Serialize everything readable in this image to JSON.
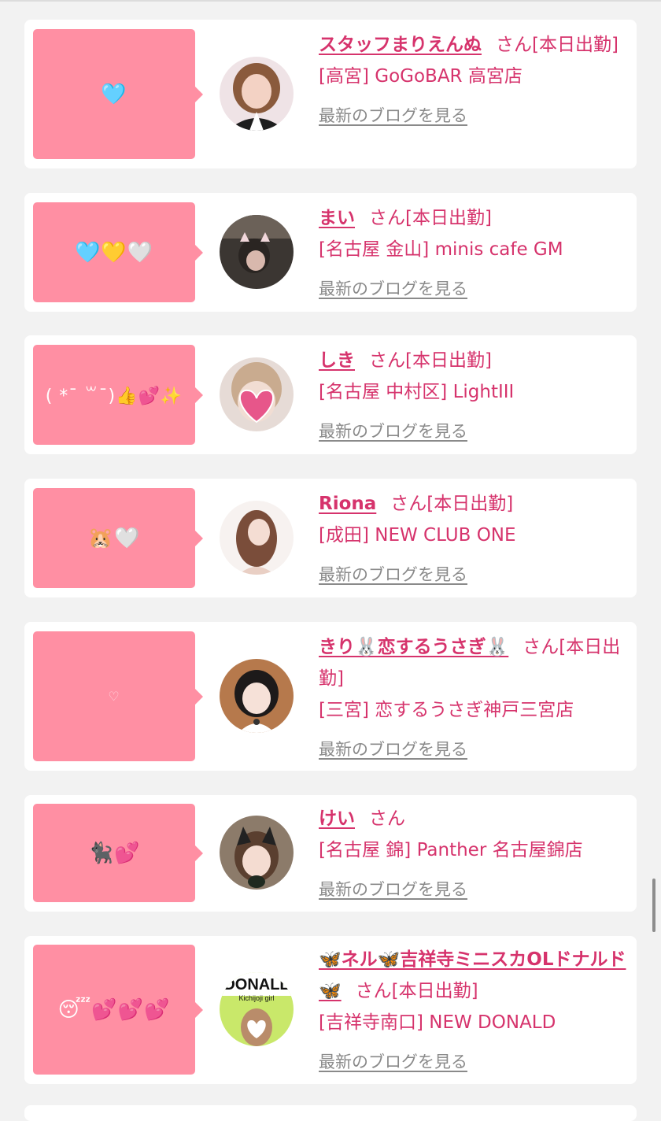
{
  "entries": [
    {
      "comment": "🩵",
      "name": "スタッフまりえんぬ",
      "suffix": "さん[本日出勤]",
      "shop": "[高宮] GoGoBAR 高宮店",
      "blog_link": "最新のブログを見る"
    },
    {
      "comment": "🩵💛🤍",
      "name": "まい",
      "suffix": "さん[本日出勤]",
      "shop": "[名古屋 金山] minis cafe GM",
      "blog_link": "最新のブログを見る"
    },
    {
      "comment": "( *¯ ꒳¯)👍💕✨",
      "name": "しき",
      "suffix": "さん[本日出勤]",
      "shop": "[名古屋 中村区] LightIII",
      "blog_link": "最新のブログを見る"
    },
    {
      "comment": "🐹🤍",
      "name": "Riona",
      "suffix": "さん[本日出勤]",
      "shop": "[成田] NEW CLUB ONE",
      "blog_link": "最新のブログを見る"
    },
    {
      "comment": "♡",
      "name": "きり🐰恋するうさぎ🐰",
      "suffix": "さん[本日出勤]",
      "shop": "[三宮] 恋するうさぎ神戸三宮店",
      "blog_link": "最新のブログを見る"
    },
    {
      "comment": "🐈‍⬛💕",
      "name": "けい",
      "suffix": "さん",
      "shop": "[名古屋 錦] Panther 名古屋錦店",
      "blog_link": "最新のブログを見る"
    },
    {
      "comment": "😴💕💕💕",
      "name": "🦋ネル🦋吉祥寺ミニスカOLドナルド🦋",
      "suffix": "さん[本日出勤]",
      "shop": "[吉祥寺南口] NEW DONALD",
      "blog_link": "最新のブログを見る",
      "avatar_text": "DONALL",
      "avatar_subtext": "Kichijoji girl"
    }
  ]
}
